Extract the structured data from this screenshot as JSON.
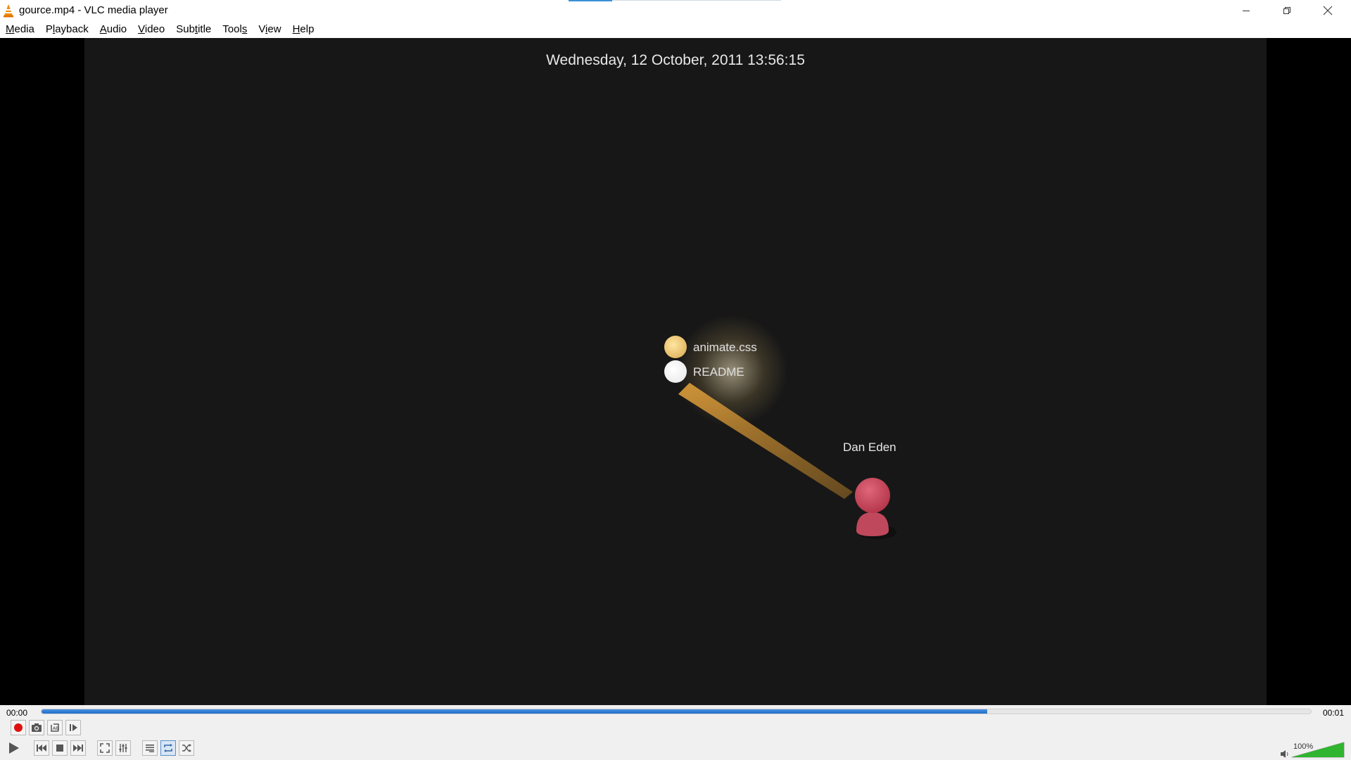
{
  "window": {
    "title": "gource.mp4 - VLC media player",
    "icon": "vlc-cone-icon"
  },
  "menu": {
    "items": [
      {
        "label": "Media",
        "mnemonic": "M"
      },
      {
        "label": "Playback",
        "mnemonic": "l"
      },
      {
        "label": "Audio",
        "mnemonic": "A"
      },
      {
        "label": "Video",
        "mnemonic": "V"
      },
      {
        "label": "Subtitle",
        "mnemonic": "t"
      },
      {
        "label": "Tools",
        "mnemonic": "s"
      },
      {
        "label": "View",
        "mnemonic": "i"
      },
      {
        "label": "Help",
        "mnemonic": "H"
      }
    ]
  },
  "video": {
    "date_text": "Wednesday, 12 October, 2011 13:56:15",
    "nodes": [
      {
        "label": "animate.css",
        "color": "#e6b860"
      },
      {
        "label": "README",
        "color": "#ffffff"
      }
    ],
    "user": {
      "name": "Dan Eden",
      "color": "#c9455a"
    },
    "beam_color": "#d89a3a"
  },
  "playback": {
    "elapsed": "00:00",
    "total": "00:01",
    "progress_fraction": 0.745
  },
  "controls": {
    "row1": [
      "record-icon",
      "snapshot-icon",
      "loop-ab-icon",
      "frame-step-icon"
    ],
    "row2": [
      "play-icon",
      "previous-icon",
      "stop-icon",
      "next-icon",
      "fullscreen-icon",
      "extended-settings-icon",
      "playlist-icon",
      "loop-icon",
      "shuffle-icon"
    ],
    "loop_active": true
  },
  "volume": {
    "percent_label": "100%",
    "level_fraction": 1.0,
    "accent": "#2fb52f"
  }
}
